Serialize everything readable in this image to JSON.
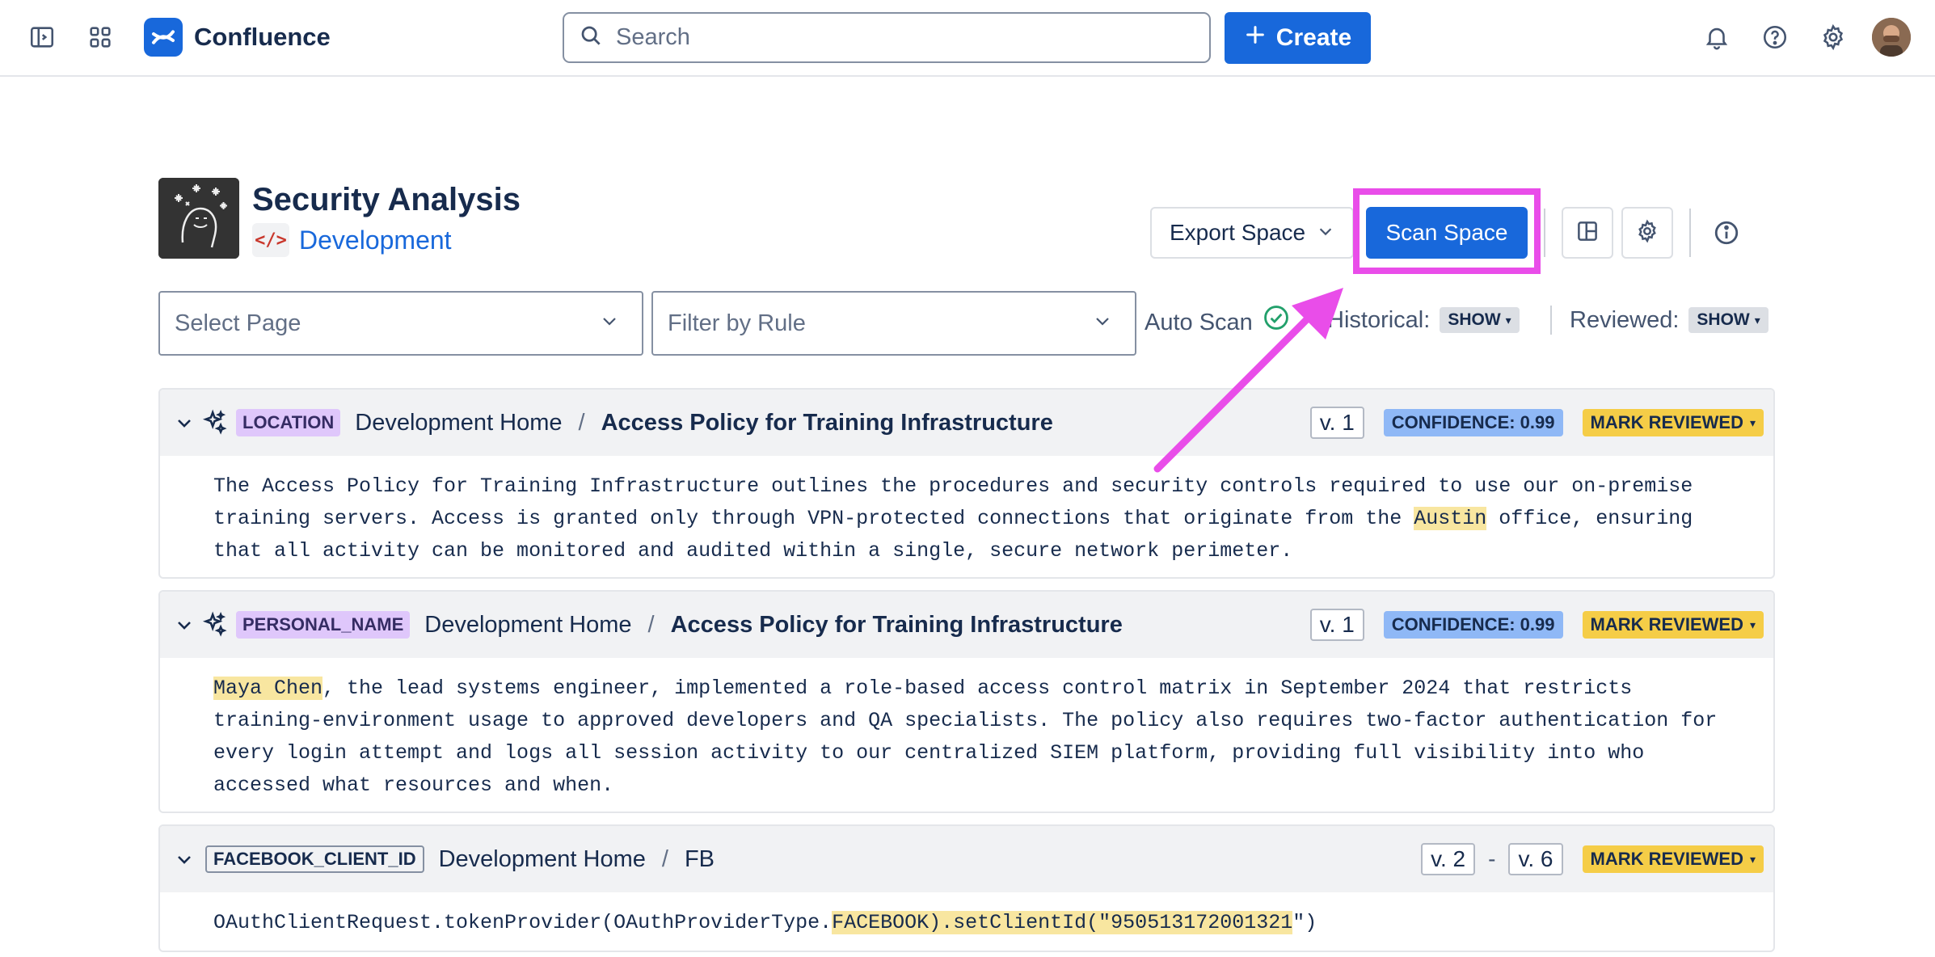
{
  "topbar": {
    "brand": "Confluence",
    "search_placeholder": "Search",
    "create_label": "Create"
  },
  "space": {
    "title": "Security Analysis",
    "subtitle": "Development",
    "code_glyph": "</>"
  },
  "toolbar": {
    "export_label": "Export Space",
    "scan_label": "Scan Space"
  },
  "filters": {
    "select_page": "Select Page",
    "filter_rule": "Filter by Rule",
    "auto_scan": "Auto Scan",
    "historical_label": "Historical:",
    "historical_value": "SHOW",
    "reviewed_label": "Reviewed:",
    "reviewed_value": "SHOW"
  },
  "results": [
    {
      "tag": "LOCATION",
      "crumb_root": "Development Home",
      "crumb_sep": "/",
      "crumb_page": "Access Policy for Training Infrastructure",
      "version": "v. 1",
      "confidence": "CONFIDENCE: 0.99",
      "mark_label": "MARK REVIEWED",
      "text_before": "The Access Policy for Training Infrastructure outlines the procedures and security controls required to use our on-premise training servers. Access is granted only through VPN-protected connections that originate from the ",
      "text_match": "Austin",
      "text_after": " office, ensuring that all activity can be monitored and audited within a single, secure network perimeter."
    },
    {
      "tag": "PERSONAL_NAME",
      "crumb_root": "Development Home",
      "crumb_sep": "/",
      "crumb_page": "Access Policy for Training Infrastructure",
      "version": "v. 1",
      "confidence": "CONFIDENCE: 0.99",
      "mark_label": "MARK REVIEWED",
      "text_before": "",
      "text_match": "Maya Chen",
      "text_after": ", the lead systems engineer, implemented a role-based access control matrix in September 2024 that restricts training-environment usage to approved developers and QA specialists. The policy also requires two-factor authentication for every login attempt and logs all session activity to our centralized SIEM platform, providing full visibility into who accessed what resources and when."
    },
    {
      "tag": "FACEBOOK_CLIENT_ID",
      "crumb_root": "Development Home",
      "crumb_sep": "/",
      "crumb_page": "FB",
      "version_from": "v. 2",
      "version_dash": "-",
      "version_to": "v. 6",
      "mark_label": "MARK REVIEWED",
      "text_before": "OAuthClientRequest.tokenProvider(OAuthProviderType.",
      "text_match": "FACEBOOK).setClientId(\"950513172001321",
      "text_after": "\")"
    }
  ],
  "colors": {
    "primary": "#1868db",
    "annotation": "#e94de9",
    "highlight": "#f8e6a0",
    "tag_purple": "#dfc7fb",
    "confidence": "#8fb8f6",
    "mark_reviewed": "#f5cd47"
  }
}
